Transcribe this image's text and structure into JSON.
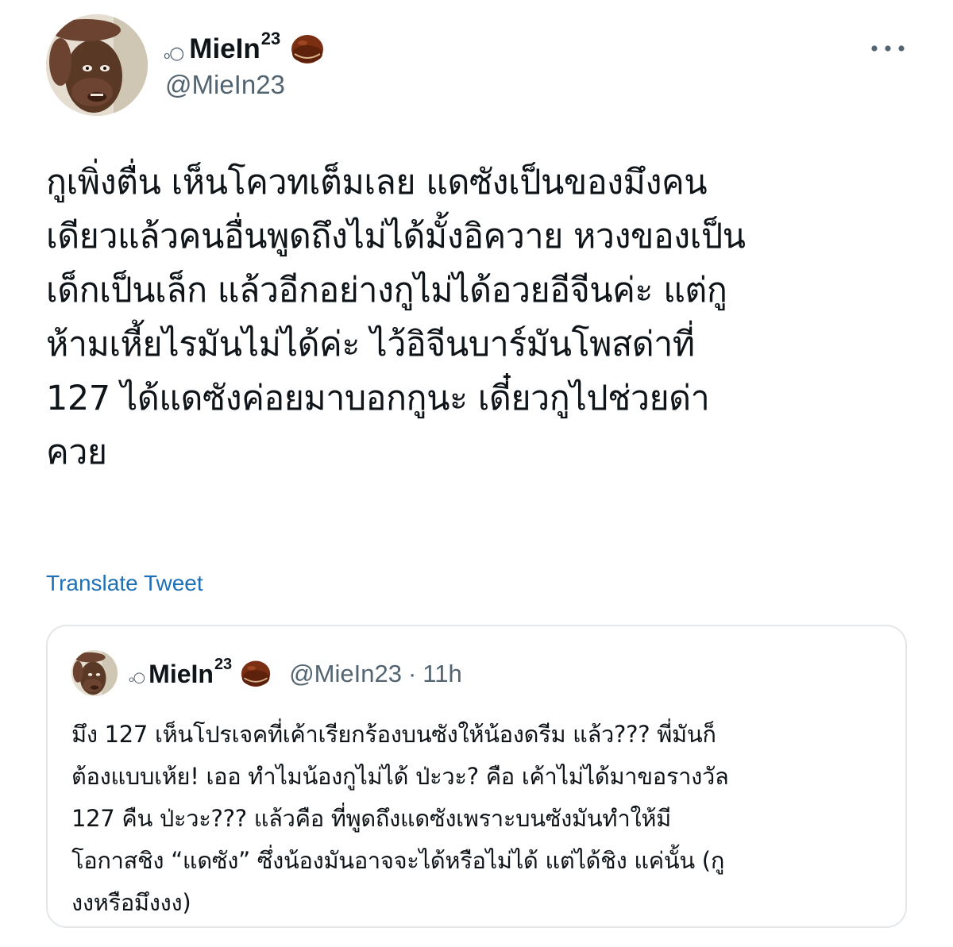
{
  "tweet": {
    "author": {
      "prefix": "ₒ○",
      "display_name": "MieIn",
      "display_name_sup": "23",
      "handle": "@MieIn23",
      "badge_icon": "chestnut-icon"
    },
    "text": "กูเพิ่งตื่น เห็นโควทเต็มเลย แดซังเป็นของมึงคน\nเดียวแล้วคนอื่นพูดถึงไม่ได้มั้งอิควาย หวงของเป็น\nเด็กเป็นเล็ก แล้วอีกอย่างกูไม่ได้อวยอีจีนค่ะ แต่กู\nห้ามเหี้ยไรมันไม่ได้ค่ะ ไว้อิจีนบาร์มันโพสด่าที่\n127 ได้แดซังค่อยมาบอกกูนะ เดี๋ยวกูไปช่วยด่า\nควย",
    "translate_label": "Translate Tweet",
    "more_icon": "more-horizontal-icon"
  },
  "quoted_tweet": {
    "author": {
      "prefix": "ₒ○",
      "display_name": "MieIn",
      "display_name_sup": "23",
      "handle": "@MieIn23",
      "separator": "·",
      "time": "11h",
      "badge_icon": "chestnut-icon"
    },
    "text": "มึง 127 เห็นโปรเจคที่เค้าเรียกร้องบนซังให้น้องดรีม แล้ว??? พี่มันก็\nต้องแบบเห้ย! เออ ทำไมน้องกูไม่ได้ ป่ะวะ? คือ เค้าไม่ได้มาขอรางวัล\n127 คืน ป่ะวะ??? แล้วคือ ที่พูดถึงแดซังเพราะบนซังมันทำให้มี\nโอกาสชิง “แดซัง” ซึ่งน้องมันอาจจะได้หรือไม่ได้ แต่ได้ชิง แค่นั้น (กู\nงงหรือมึงงง)"
  },
  "colors": {
    "text": "#0f1419",
    "secondary": "#536471",
    "link": "#1d6fb8",
    "border": "#e3e7ea",
    "background": "#ffffff"
  }
}
